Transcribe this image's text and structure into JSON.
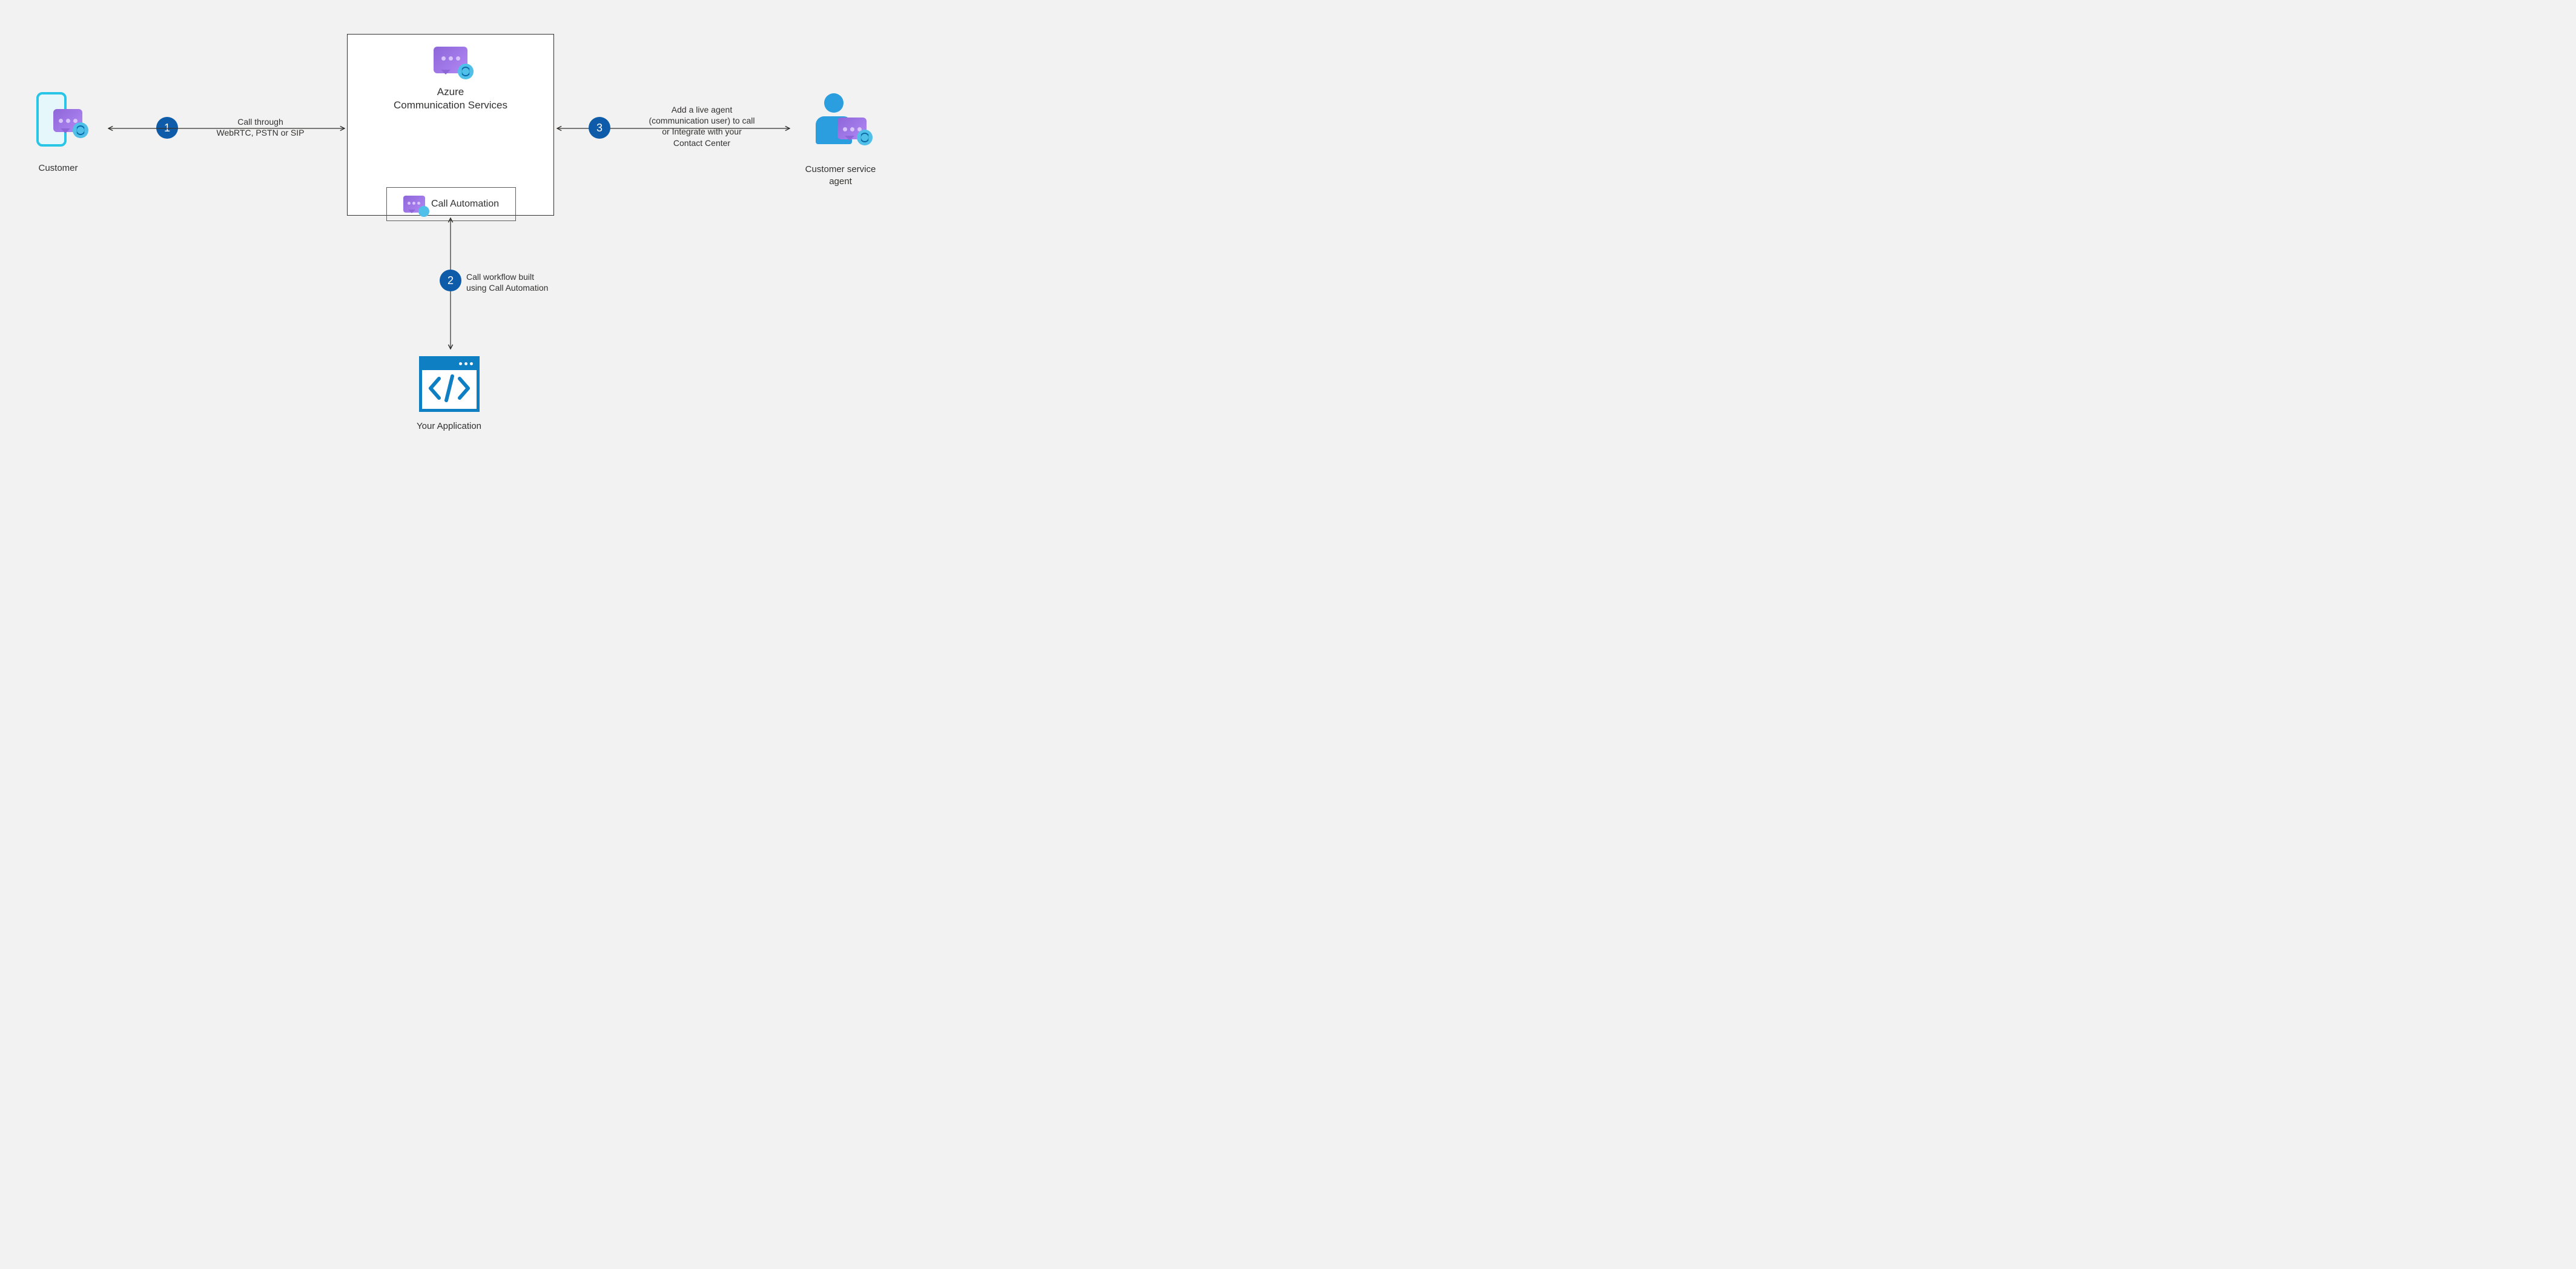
{
  "nodes": {
    "customer": {
      "label": "Customer"
    },
    "acs": {
      "line1": "Azure",
      "line2": "Communication Services"
    },
    "call_automation": {
      "label": "Call Automation"
    },
    "agent": {
      "line1": "Customer service",
      "line2": "agent"
    },
    "your_app": {
      "label": "Your Application"
    }
  },
  "steps": {
    "1": {
      "num": "1",
      "label_line1": "Call through",
      "label_line2": "WebRTC, PSTN or SIP"
    },
    "2": {
      "num": "2",
      "label_line1": "Call workflow built",
      "label_line2": "using Call Automation"
    },
    "3": {
      "num": "3",
      "label_line1": "Add a live agent",
      "label_line2": "(communication user) to call",
      "label_line3": "or Integrate with your",
      "label_line4": "Contact Center"
    }
  },
  "colors": {
    "badge": "#0e5ca9",
    "accentBlue": "#1e90d8",
    "chatPurple": "#8d66d8",
    "phoneCircle": "#50c0e8"
  }
}
